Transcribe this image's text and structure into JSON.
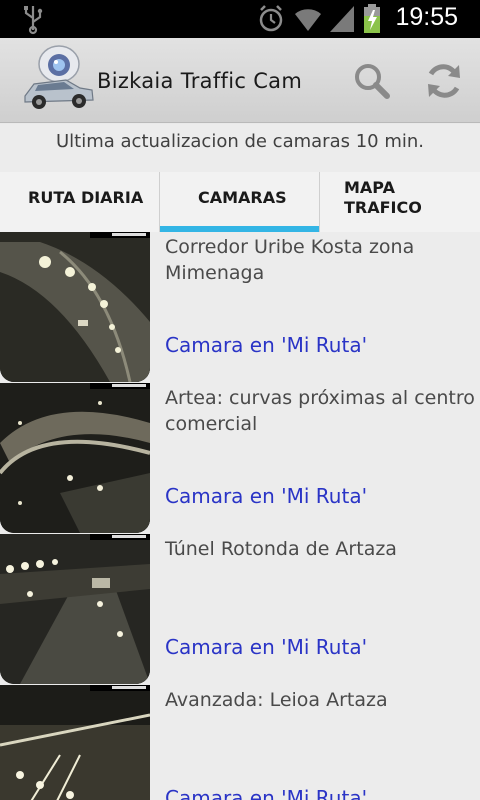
{
  "status_bar": {
    "time": "19:55",
    "icons": [
      "usb-icon",
      "alarm-icon",
      "wifi-icon",
      "signal-icon",
      "battery-charging-icon"
    ]
  },
  "action_bar": {
    "title": "Bizkaia Traffic Cam",
    "search_icon": "search-icon",
    "refresh_icon": "refresh-icon"
  },
  "notice": "Ultima actualizacion de camaras 10 min.",
  "tabs": [
    {
      "label": "RUTA DIARIA",
      "active": false
    },
    {
      "label": "CAMARAS",
      "active": true
    },
    {
      "label": "MAPA\nTRAFICO",
      "active": false
    }
  ],
  "cameras": [
    {
      "title": "Corredor Uribe Kosta zona Mimenaga",
      "link": "Camara en 'Mi Ruta'"
    },
    {
      "title": "Artea: curvas próximas al centro comercial",
      "link": "Camara en 'Mi Ruta'"
    },
    {
      "title": "Túnel Rotonda de Artaza",
      "link": "Camara en 'Mi Ruta'"
    },
    {
      "title": "Avanzada: Leioa Artaza",
      "link": "Camara en 'Mi Ruta'"
    }
  ],
  "colors": {
    "accent": "#33b5e5",
    "link": "#2a34c6"
  }
}
